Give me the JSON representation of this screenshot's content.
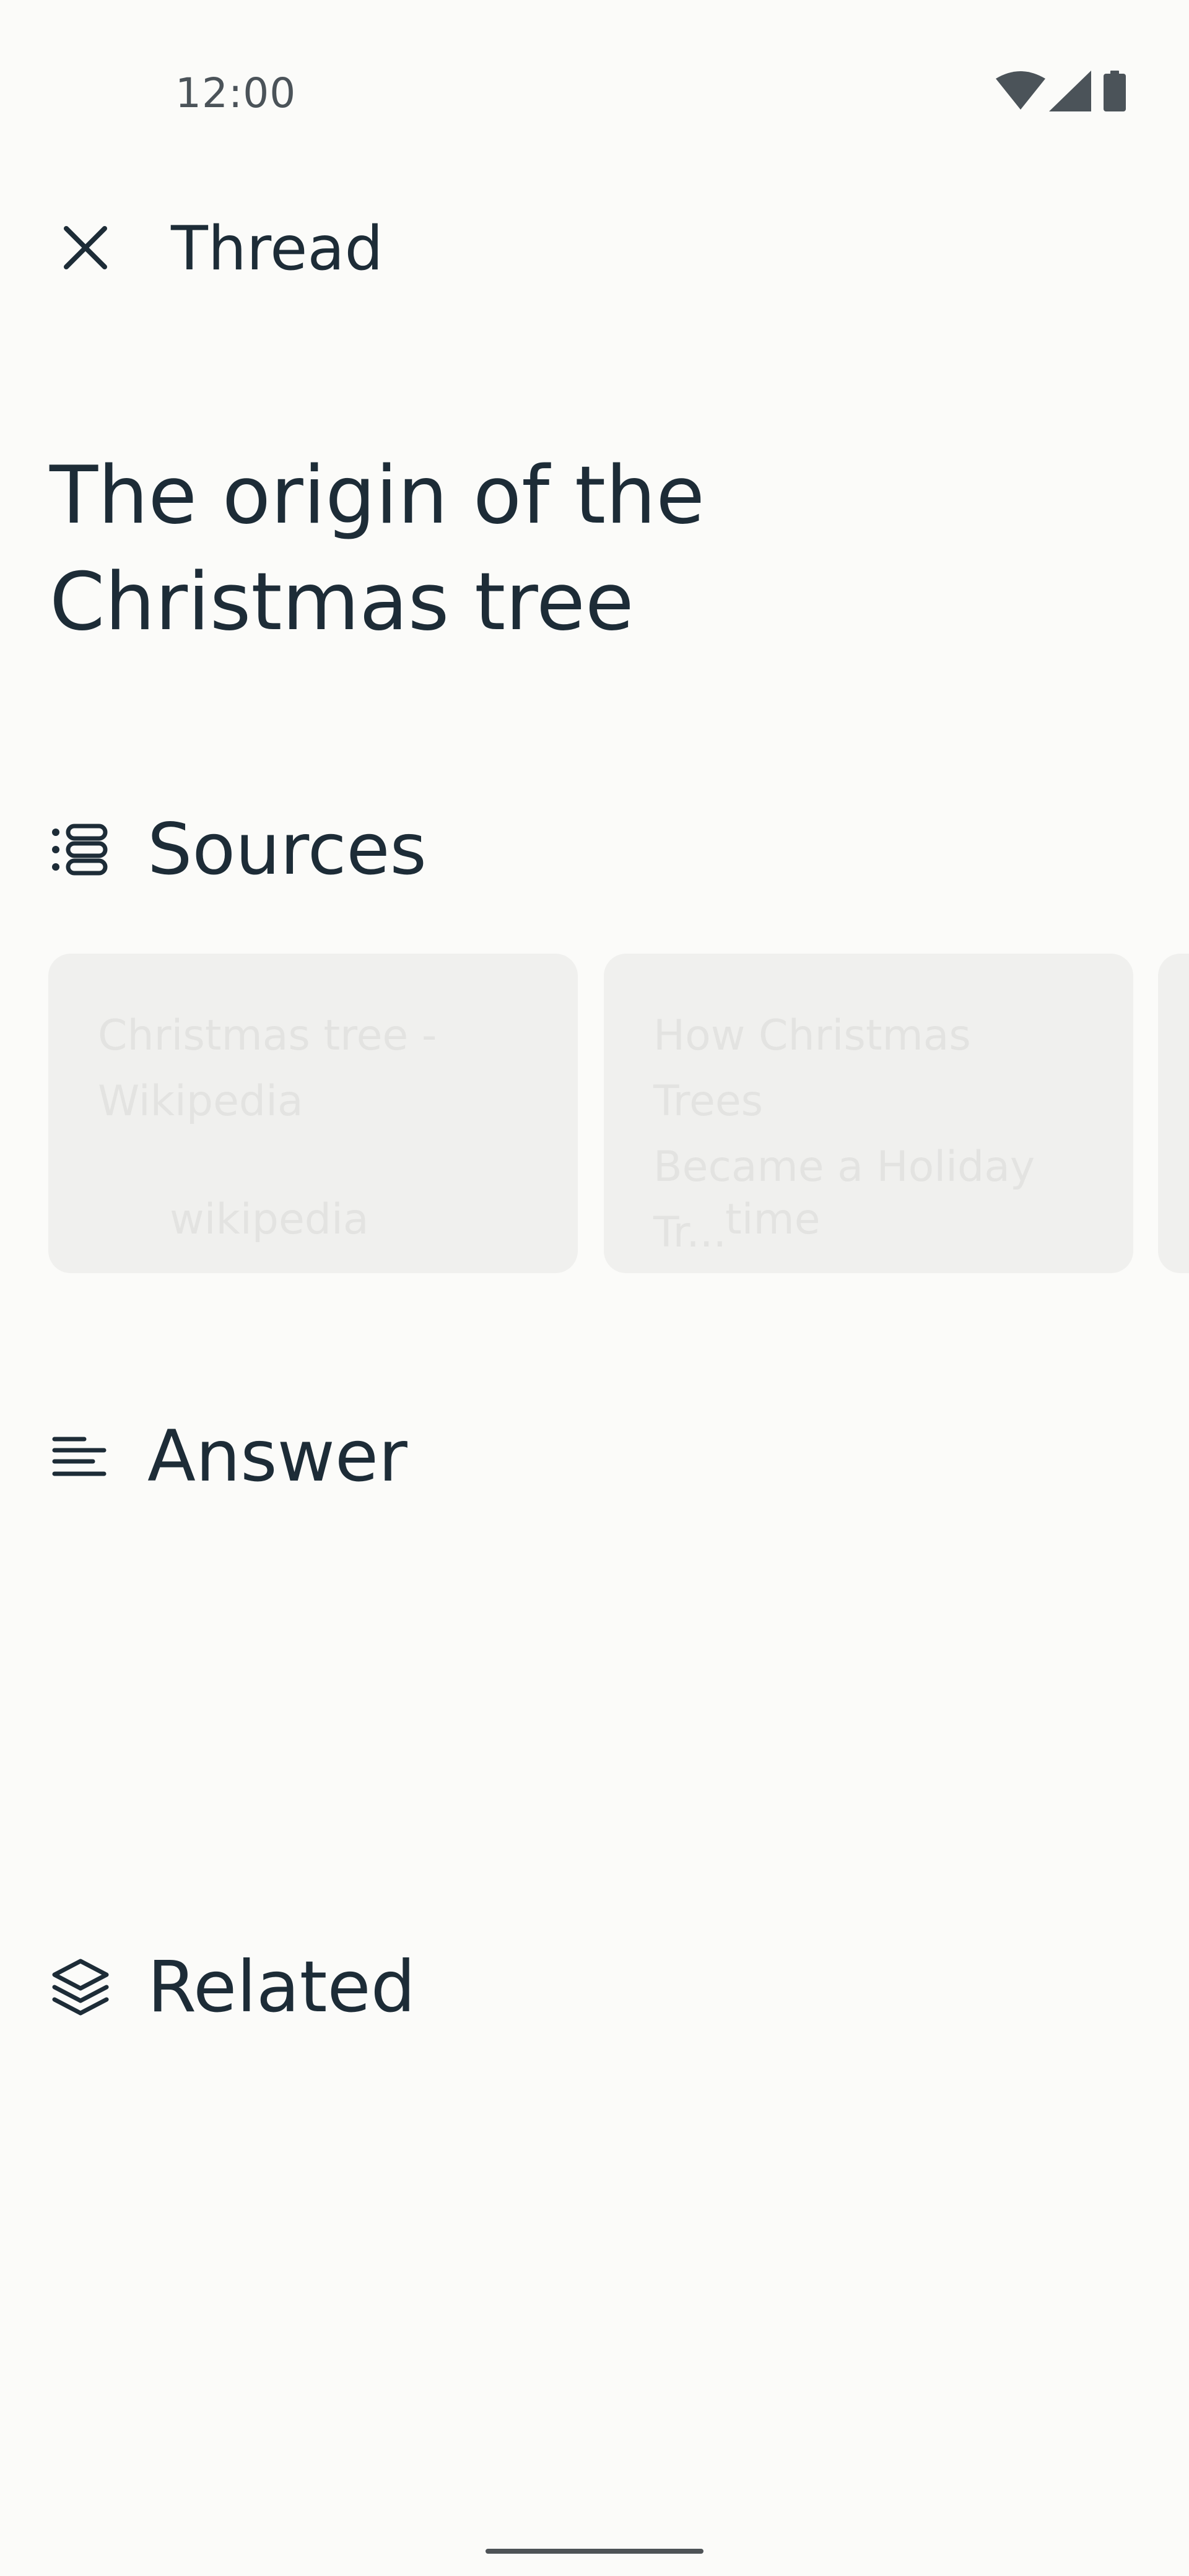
{
  "status_bar": {
    "time": "12:00",
    "icons": [
      "wifi-icon",
      "cellular-signal-icon",
      "battery-icon"
    ]
  },
  "top_bar": {
    "close_icon": "close-icon",
    "title": "Thread"
  },
  "page": {
    "title": "The origin of the\nChristmas tree"
  },
  "sections": {
    "sources": {
      "label": "Sources",
      "icon": "sources-list-icon"
    },
    "answer": {
      "label": "Answer",
      "icon": "text-lines-icon"
    },
    "related": {
      "label": "Related",
      "icon": "layers-icon"
    }
  },
  "sources": [
    {
      "title": "Christmas tree -\nWikipedia",
      "domain": "wikipedia"
    },
    {
      "title": "How Christmas Trees\nBecame a Holiday Tr...",
      "domain": "time"
    },
    {
      "title": "",
      "domain": ""
    }
  ],
  "colors": {
    "background": "#fbfbf9",
    "text": "#1d2c37",
    "card": "#f0f0ee",
    "card_placeholder_text": "#e3e3e1"
  }
}
